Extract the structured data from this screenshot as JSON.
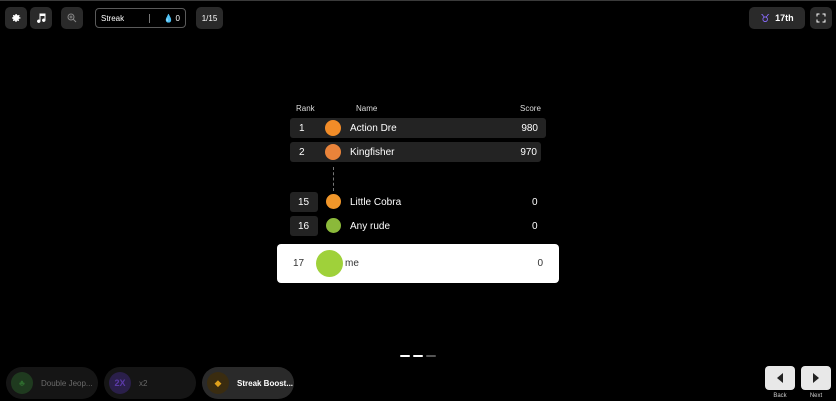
{
  "toolbar": {
    "settings_icon": "gear-icon",
    "music_icon": "music-note-icon",
    "zoom_icon": "zoom-in-icon",
    "streak_label": "Streak",
    "streak_value": "0",
    "question_counter": "1/15",
    "my_rank": "17th",
    "fullscreen_icon": "fullscreen-icon"
  },
  "leaderboard": {
    "headers": {
      "rank": "Rank",
      "name": "Name",
      "score": "Score"
    },
    "rows": [
      {
        "rank": "1",
        "name": "Action Dre",
        "score": "980"
      },
      {
        "rank": "2",
        "name": "Kingfisher",
        "score": "970"
      },
      {
        "rank": "15",
        "name": "Little Cobra",
        "score": "0"
      },
      {
        "rank": "16",
        "name": "Any rude",
        "score": "0"
      }
    ],
    "me": {
      "rank": "17",
      "name": "me",
      "score": "0"
    }
  },
  "pager": {
    "pages": 3,
    "active": 1
  },
  "powerups": [
    {
      "label": "Double Jeop...",
      "state": "disabled",
      "color": "#2e6b2e"
    },
    {
      "label": "x2",
      "icon_text": "2X",
      "state": "disabled",
      "color": "#5b3aa8"
    },
    {
      "label": "Streak Boost...",
      "state": "active",
      "color": "#e0a11b"
    }
  ],
  "nav": {
    "back_label": "Back",
    "next_label": "Next"
  },
  "colors": {
    "background": "#000000",
    "panel": "#2a2a2a",
    "accent": "#8a6cff"
  }
}
